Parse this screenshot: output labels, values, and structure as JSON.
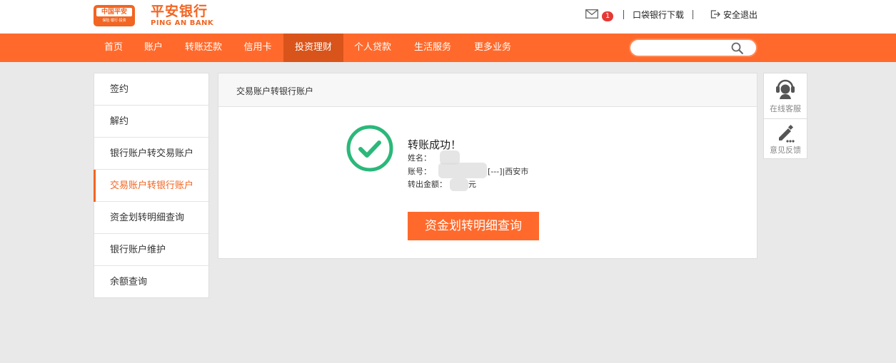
{
  "header": {
    "logo_badge_cn": "中国平安",
    "logo_badge_tag": "保险·银行·投资",
    "brand_cn": "平安银行",
    "brand_en": "PING AN BANK",
    "mail_count": "1",
    "app_download": "口袋银行下载",
    "logout": "安全退出"
  },
  "nav": {
    "items": [
      "首页",
      "账户",
      "转账还款",
      "信用卡",
      "投资理财",
      "个人贷款",
      "生活服务",
      "更多业务"
    ],
    "active_index": 4,
    "search_placeholder": ""
  },
  "sidebar": {
    "items": [
      "签约",
      "解约",
      "银行账户转交易账户",
      "交易账户转银行账户",
      "资金划转明细查询",
      "银行账户维护",
      "余额查询"
    ],
    "active_index": 3
  },
  "main": {
    "title": "交易账户转银行账户",
    "success_text": "转账成功！",
    "name_label": "姓名：",
    "account_label": "账号：",
    "account_suffix": "[---]|西安市",
    "amount_label": "转出金额：",
    "amount_unit": "元",
    "detail_button": "资金划转明细查询"
  },
  "float_tools": {
    "service": "在线客服",
    "feedback": "意见反馈"
  },
  "colors": {
    "brand_orange": "#ff6a2c",
    "nav_active": "#d9541a",
    "success_green": "#2bb87a"
  }
}
